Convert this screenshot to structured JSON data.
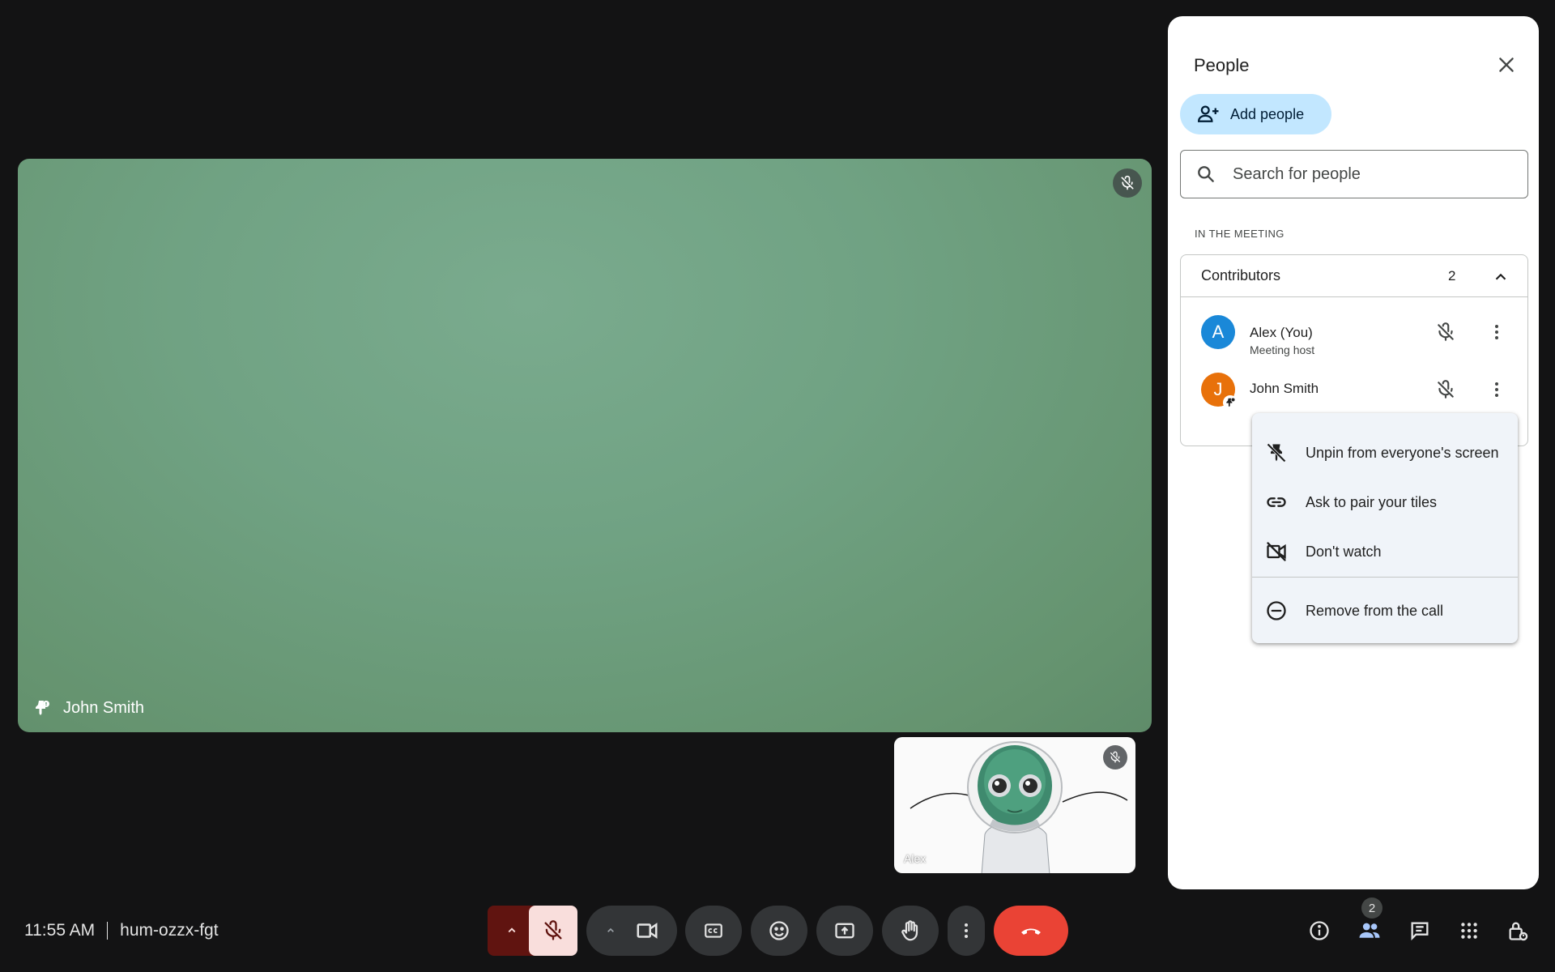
{
  "meeting": {
    "time": "11:55 AM",
    "code": "hum-ozzx-fgt"
  },
  "main_tile": {
    "participant_name": "John Smith",
    "muted": true,
    "pinned": true
  },
  "self_tile": {
    "label": "Alex",
    "muted": true
  },
  "controls": {
    "mic_muted": true,
    "participants_count": "2",
    "colors": {
      "end_call": "#ea4335",
      "mic_off_bg": "#f9dedc",
      "mic_off_chevron_bg": "#601410",
      "control_bg": "#333537"
    }
  },
  "people_panel": {
    "title": "People",
    "add_people_label": "Add people",
    "search_placeholder": "Search for people",
    "section_label": "IN THE MEETING",
    "group": {
      "title": "Contributors",
      "count": "2",
      "participants": [
        {
          "initial": "A",
          "name": "Alex (You)",
          "subtitle": "Meeting host",
          "avatar_color": "#1a88d8"
        },
        {
          "initial": "J",
          "name": "John Smith",
          "subtitle": "",
          "avatar_color": "#e8710a"
        }
      ]
    }
  },
  "context_menu": {
    "items": [
      {
        "label": "Unpin from everyone's screen",
        "icon": "unpin-icon"
      },
      {
        "label": "Ask to pair your tiles",
        "icon": "link-icon"
      },
      {
        "label": "Don't watch",
        "icon": "video-off-icon"
      },
      {
        "label": "Remove from the call",
        "icon": "remove-circle-icon"
      }
    ]
  }
}
